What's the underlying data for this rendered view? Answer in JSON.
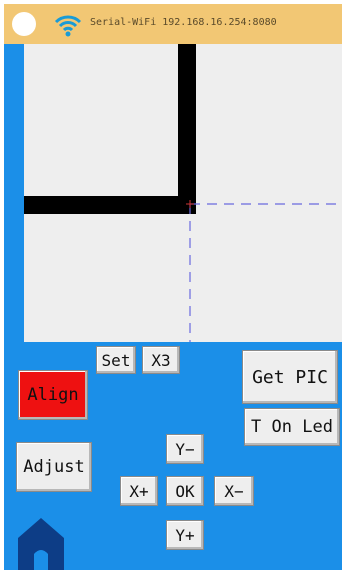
{
  "status": {
    "text": "Serial-WiFi 192.168.16.254:8080"
  },
  "controls": {
    "set_label": "Set",
    "x3_label": "X3",
    "align_label": "Align",
    "get_pic_label": "Get PIC",
    "led_label": "T On Led",
    "adjust_label": "Adjust",
    "y_minus_label": "Y−",
    "x_plus_label": "X+",
    "ok_label": "OK",
    "x_minus_label": "X−",
    "y_plus_label": "Y+"
  },
  "colors": {
    "background": "#1b8fe8",
    "status_bar": "#f2c774",
    "align_active": "#ee1111",
    "crosshair": "#6a6adf"
  },
  "icons": [
    "wifi-icon",
    "home-icon"
  ]
}
